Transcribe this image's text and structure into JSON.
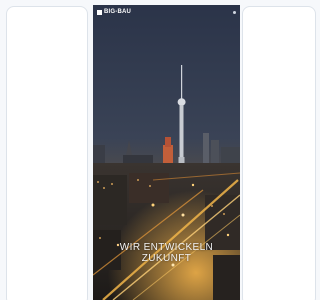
{
  "app": {
    "logo_text": "BIG-BAU",
    "menu_icon": "more-icon"
  },
  "hero": {
    "line1": "WIR ENTWICKELN",
    "line2": "ZUKUNFT"
  },
  "colors": {
    "sky": "#2a3347",
    "tower": "#d9d9d9",
    "city_lights": "#e8a83a",
    "background": "#f6f8fb"
  }
}
